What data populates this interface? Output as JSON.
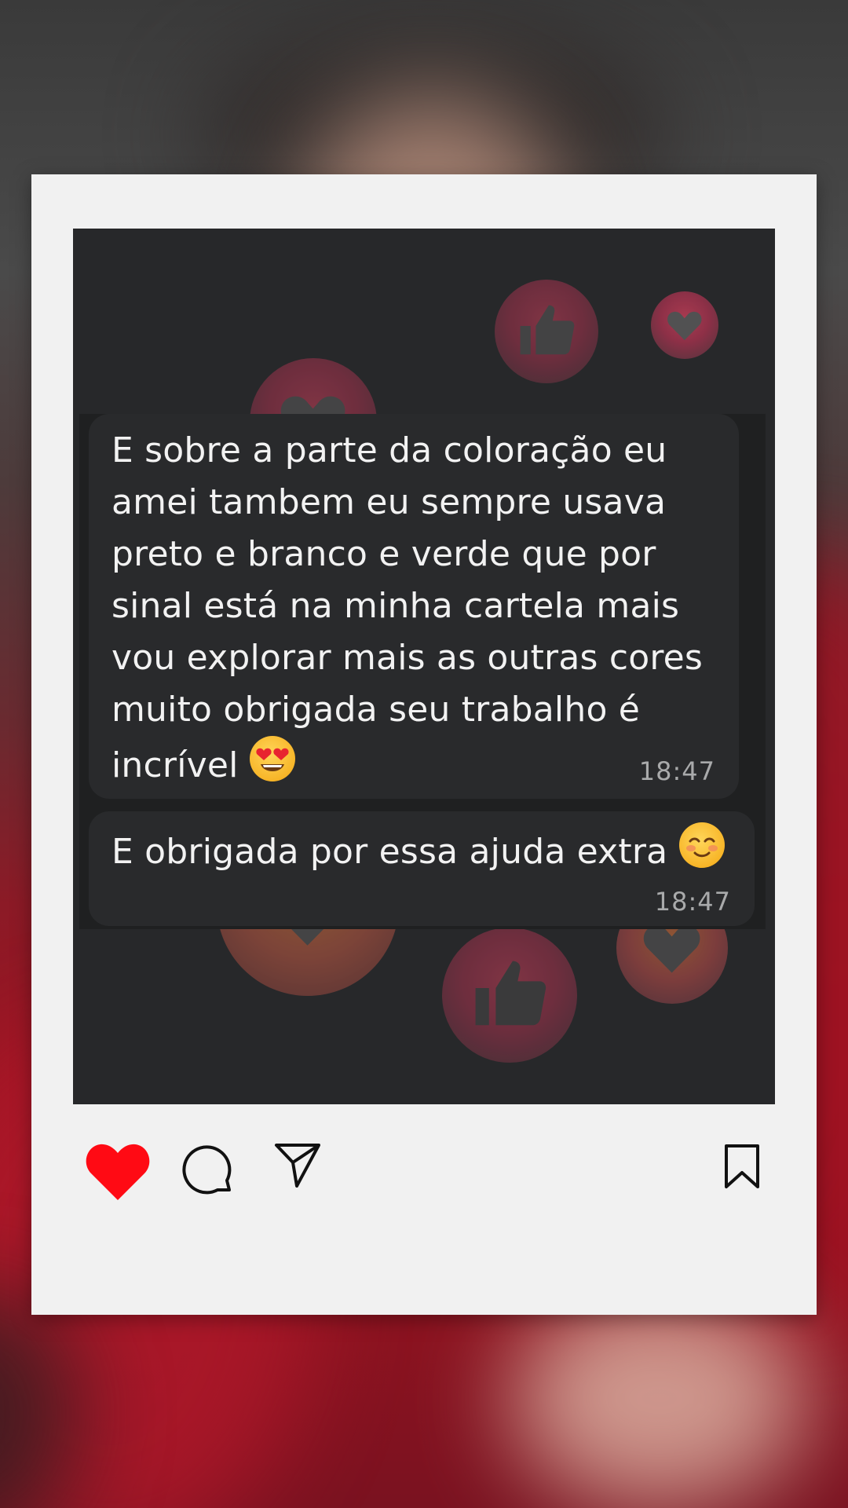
{
  "post": {
    "messages": [
      {
        "text": "E sobre a parte da coloração eu\namei tambem eu sempre usava\npreto e branco e verde que por\nsinal está na minha cartela mais\nvou explorar mais as outras cores\nmuito obrigada seu trabalho é\nincrível",
        "emoji": "heart-eyes-emoji",
        "time": "18:47"
      },
      {
        "text": "E obrigada por essa ajuda extra",
        "emoji": "smiling-blush-emoji",
        "time": "18:47"
      }
    ],
    "liked": true
  },
  "icons": {
    "like": "heart-icon",
    "comment": "comment-icon",
    "share": "send-icon",
    "save": "bookmark-icon"
  },
  "colors": {
    "like_active": "#ff0a14",
    "card": "#f1f1f1",
    "chat_bg": "#27282a",
    "bubble": "#292a2c",
    "timestamp": "#a9aaab"
  }
}
